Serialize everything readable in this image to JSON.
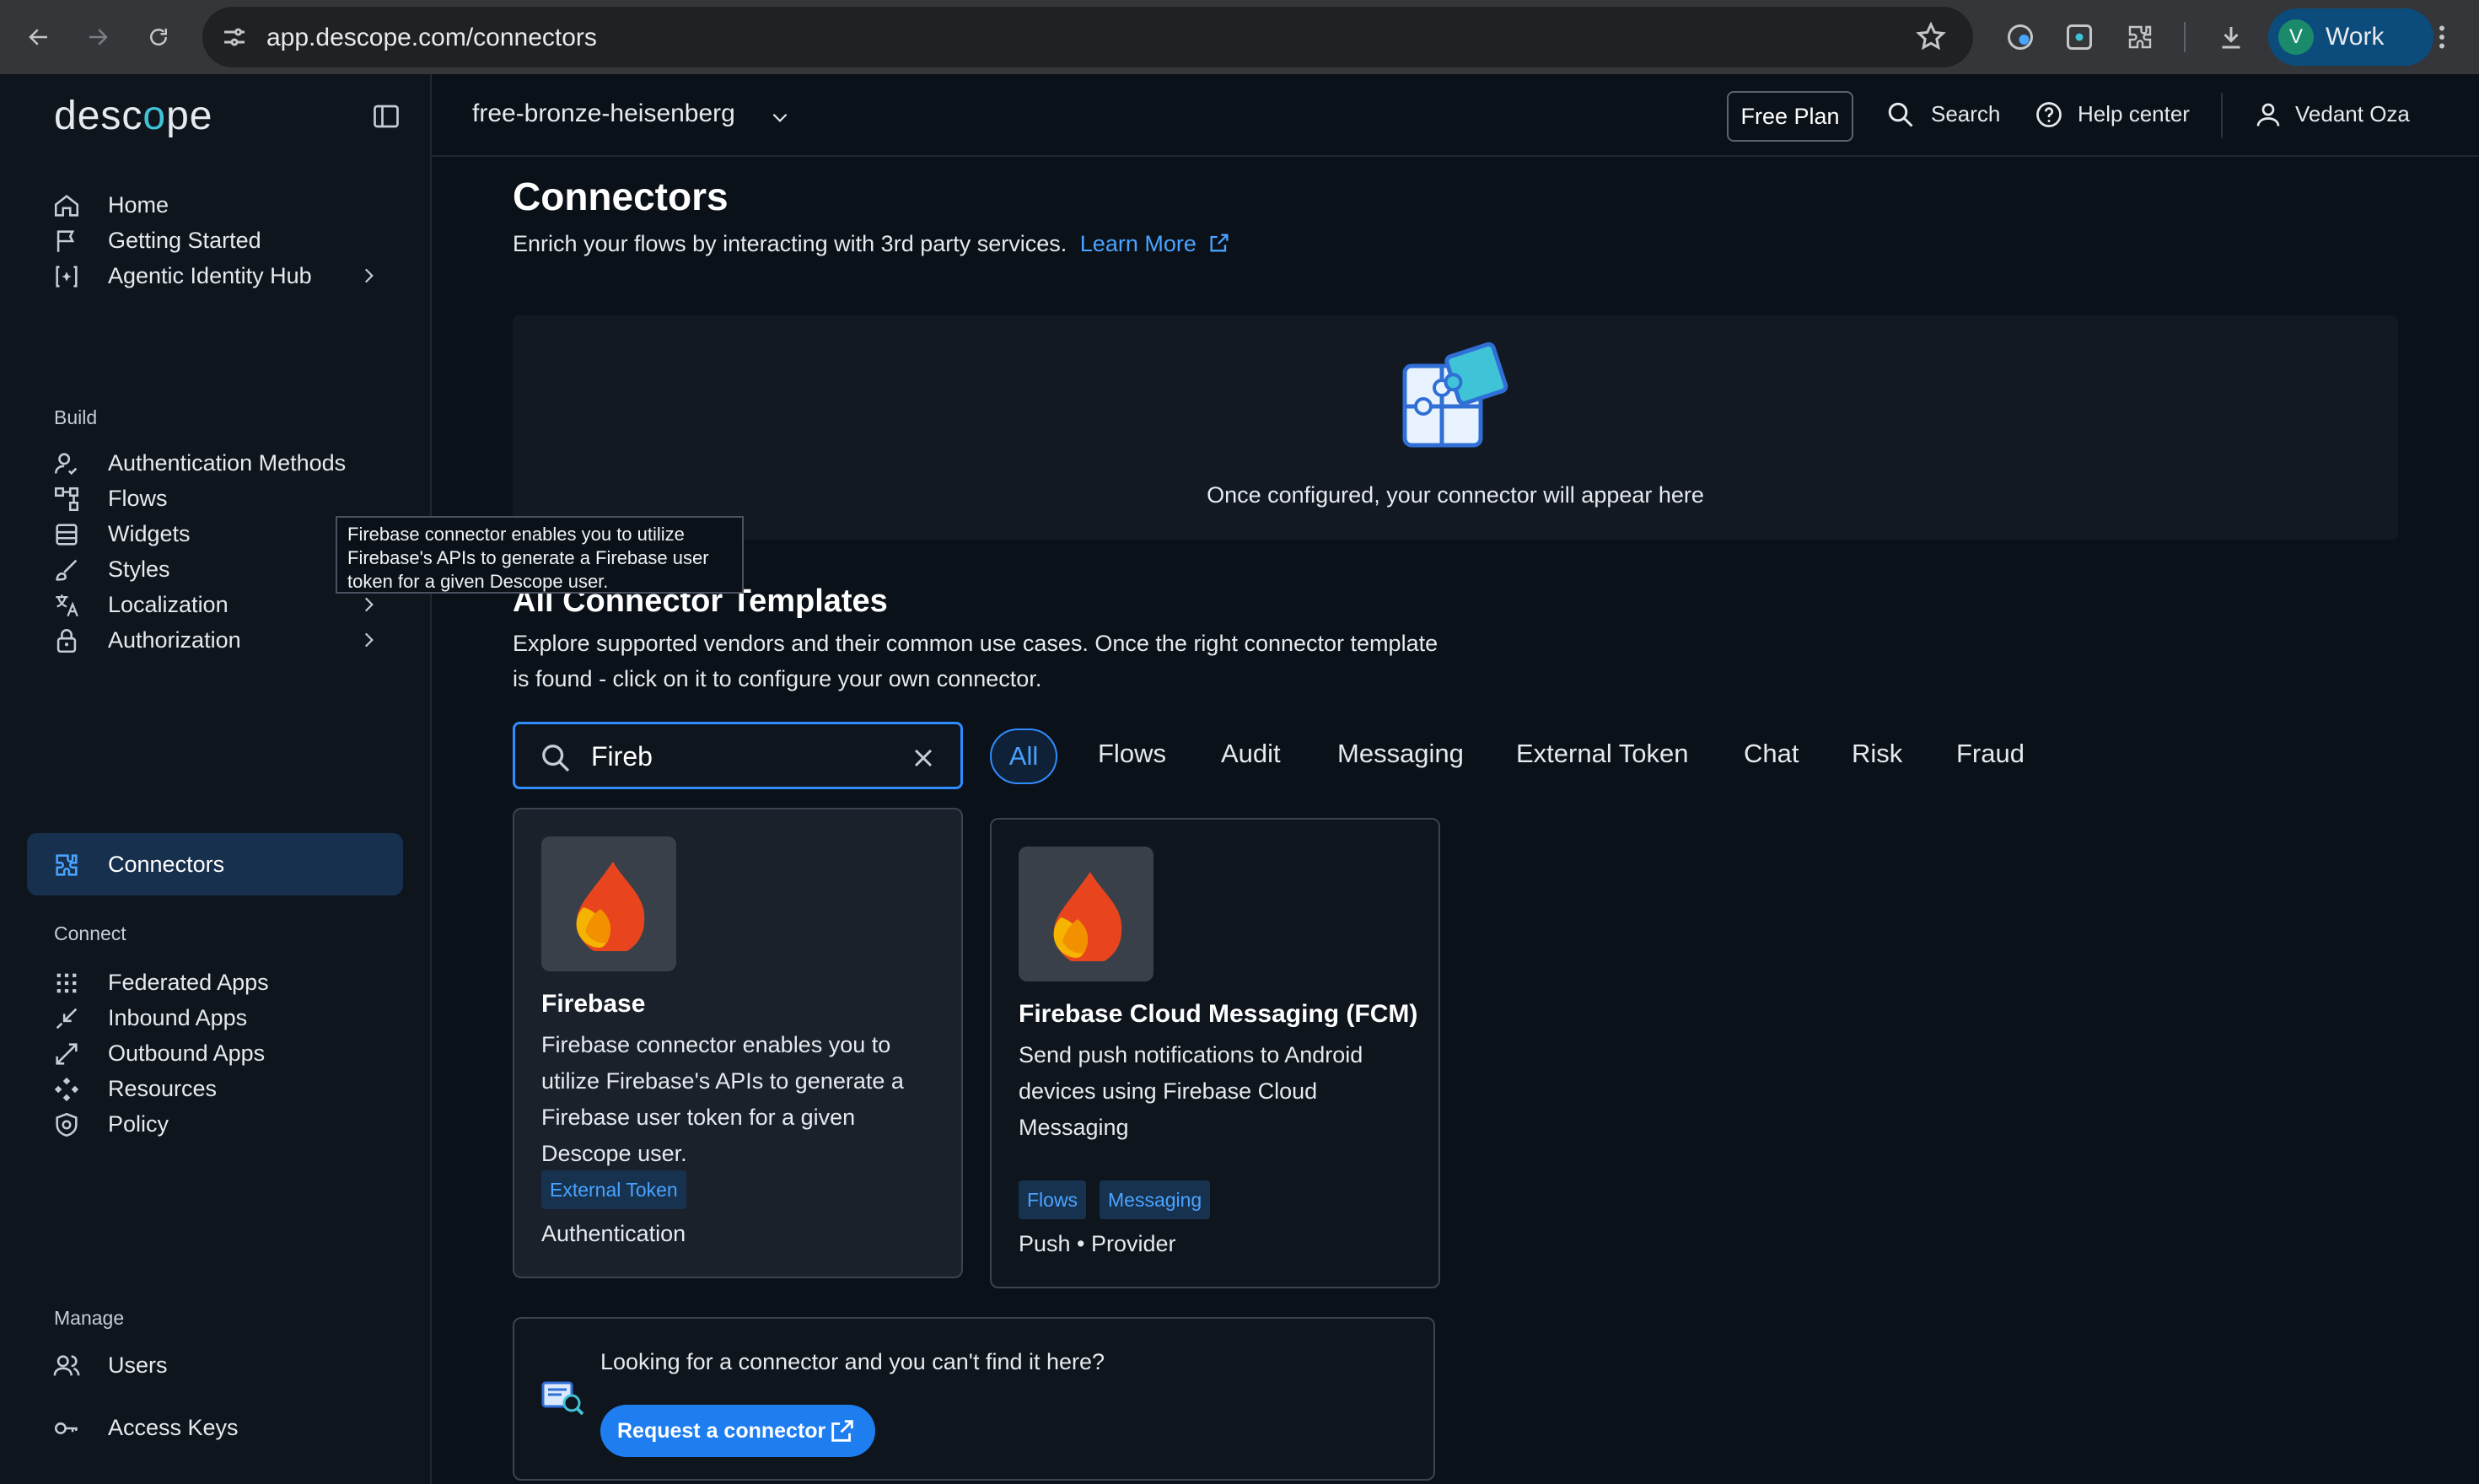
{
  "browser": {
    "url": "app.descope.com/connectors",
    "profile_initial": "V",
    "profile_name": "Work"
  },
  "sidebar": {
    "logo_left": "desc",
    "logo_dot": "o",
    "logo_right": "pe",
    "items": [
      {
        "label": "Home",
        "icon": "home-icon"
      },
      {
        "label": "Getting Started",
        "icon": "flag-icon"
      },
      {
        "label": "Agentic Identity Hub",
        "icon": "agent-icon",
        "has_chevron": true
      }
    ],
    "sections": {
      "build": "Build",
      "connect": "Connect",
      "manage": "Manage"
    },
    "build_items": [
      {
        "label": "Authentication Methods",
        "icon": "user-check-icon"
      },
      {
        "label": "Flows",
        "icon": "flow-icon"
      },
      {
        "label": "Widgets",
        "icon": "widget-icon"
      },
      {
        "label": "Styles",
        "icon": "brush-icon"
      },
      {
        "label": "Localization",
        "icon": "translate-icon",
        "has_chevron": true
      },
      {
        "label": "Authorization",
        "icon": "lock-icon",
        "has_chevron": true
      },
      {
        "label": "Connectors",
        "icon": "puzzle-icon",
        "active": true
      }
    ],
    "connect_items": [
      {
        "label": "Federated Apps",
        "icon": "grid-icon"
      },
      {
        "label": "Inbound Apps",
        "icon": "inbound-icon"
      },
      {
        "label": "Outbound Apps",
        "icon": "outbound-icon"
      },
      {
        "label": "Resources",
        "icon": "resources-icon"
      },
      {
        "label": "Policy",
        "icon": "shield-icon"
      }
    ],
    "manage_items": [
      {
        "label": "Users",
        "icon": "users-icon"
      },
      {
        "label": "Access Keys",
        "icon": "key-icon"
      }
    ]
  },
  "header": {
    "project": "free-bronze-heisenberg",
    "free_plan": "Free Plan",
    "search": "Search",
    "help": "Help center",
    "user": "Vedant Oza"
  },
  "main": {
    "title": "Connectors",
    "subtitle": "Enrich your flows by interacting with 3rd party services.",
    "learn_more": "Learn More",
    "empty_text": "Once configured, your connector will appear here",
    "templates_title": "All Connector Templates",
    "templates_sub": "Explore supported vendors and their common use cases. Once the right connector template is found - click on it to configure your own connector.",
    "search_value": "Fireb",
    "filters": [
      "All",
      "Flows",
      "Audit",
      "Messaging",
      "External Token",
      "Chat",
      "Risk",
      "Fraud"
    ]
  },
  "tooltip": "Firebase connector enables you to utilize Firebase's APIs to generate a Firebase user token for a given Descope user.",
  "cards": [
    {
      "title": "Firebase",
      "desc": "Firebase connector enables you to utilize Firebase's APIs to generate a Firebase user token for a given Descope user.",
      "tags": [
        "External Token"
      ],
      "category": "Authentication"
    },
    {
      "title": "Firebase Cloud Messaging (FCM)",
      "desc": "Send push notifications to Android devices using Firebase Cloud Messaging",
      "tags": [
        "Flows",
        "Messaging"
      ],
      "category": "Push • Provider"
    }
  ],
  "request": {
    "text": "Looking for a connector and you can't find it here?",
    "button": "Request a connector"
  },
  "colors": {
    "accent": "#2f8cff",
    "link": "#4aa3ff",
    "active_nav": "#16304e",
    "background": "#0b1119"
  }
}
